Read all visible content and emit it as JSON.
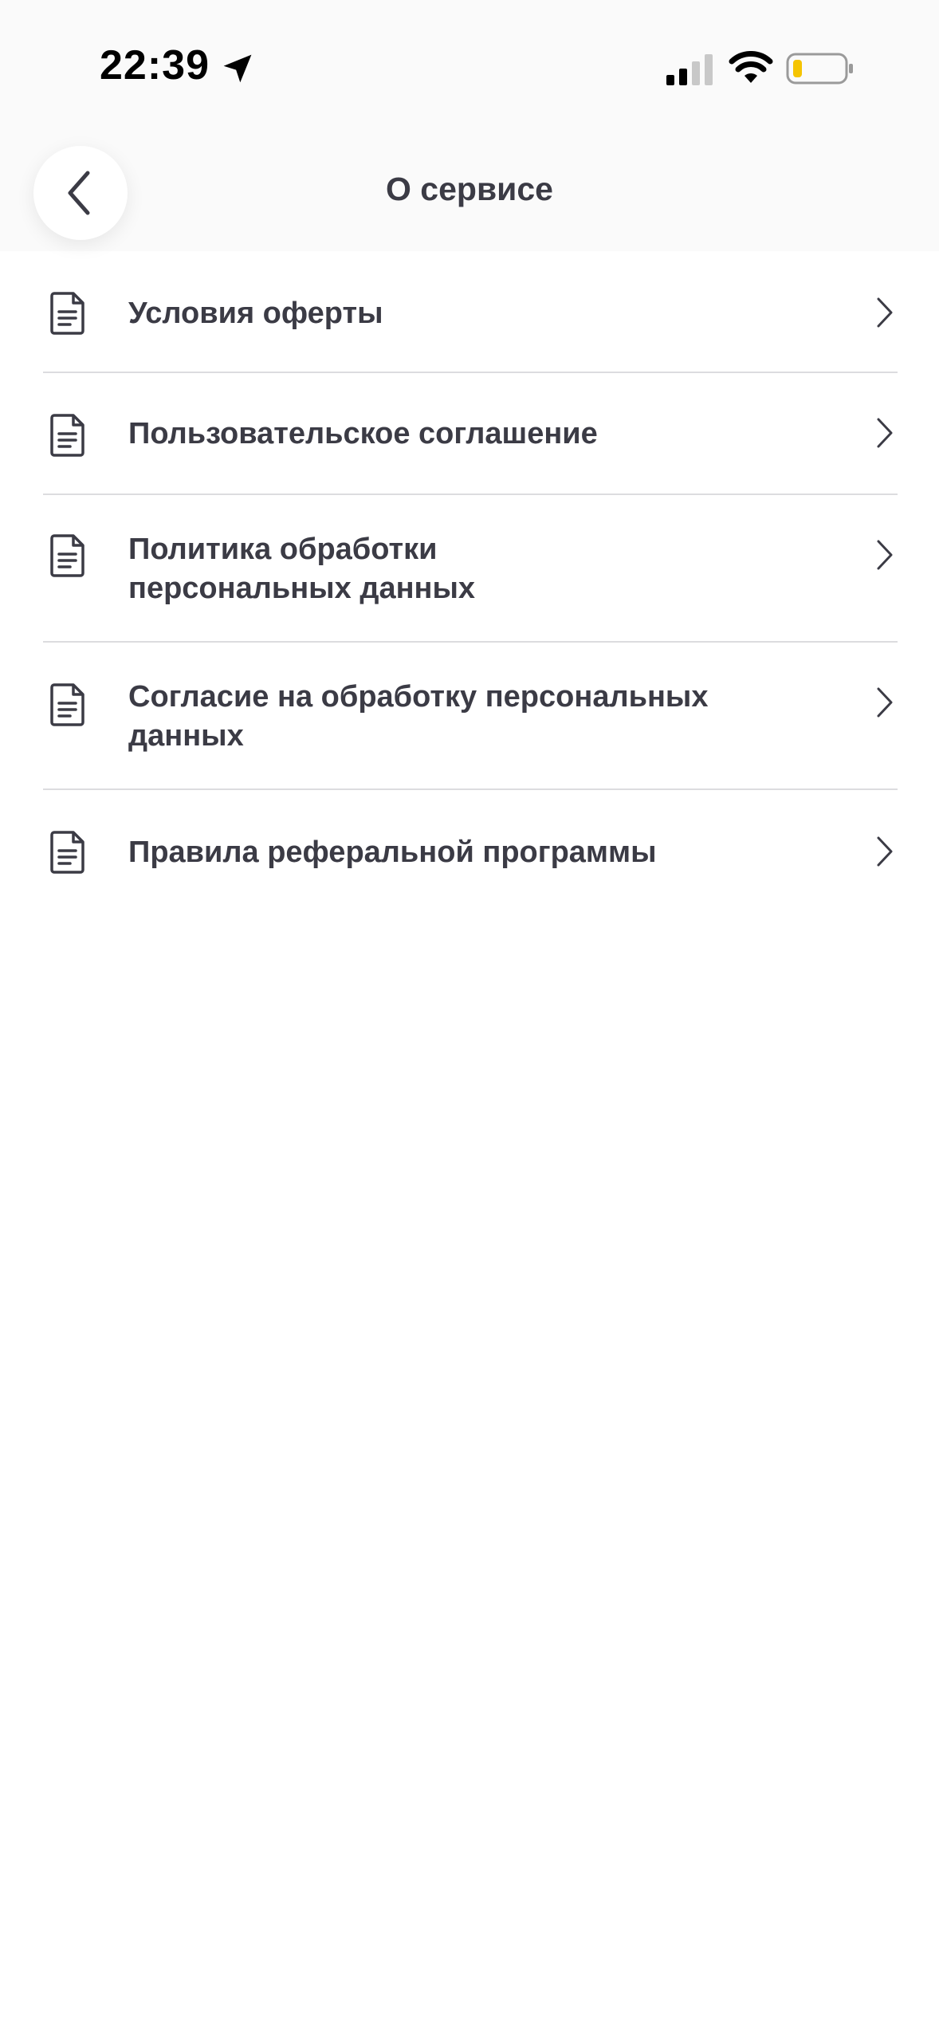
{
  "status_bar": {
    "time": "22:39",
    "location_icon": "location-arrow-icon",
    "signal_icon": "cellular-signal-icon",
    "wifi_icon": "wifi-icon",
    "battery_icon": "battery-low-icon",
    "battery_color": "#f5c400"
  },
  "header": {
    "back_icon": "chevron-left-icon",
    "title": "О сервисе"
  },
  "menu": {
    "item_icon": "document-icon",
    "chevron_icon": "chevron-right-icon",
    "items": [
      {
        "label": "Условия оферты"
      },
      {
        "label": "Пользовательское соглашение"
      },
      {
        "label": "Политика обработки персональных данных"
      },
      {
        "label": "Согласие на обработку персональных данных"
      },
      {
        "label": "Правила реферальной программы"
      }
    ]
  },
  "colors": {
    "text": "#3b3b45",
    "divider": "#dcdcdf",
    "header_bg": "#fafafa",
    "page_bg": "#ffffff"
  }
}
